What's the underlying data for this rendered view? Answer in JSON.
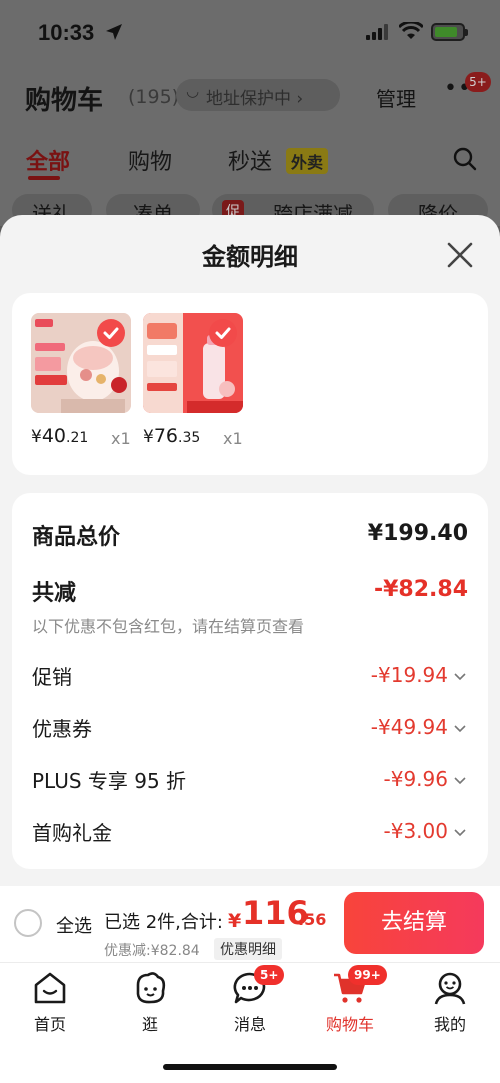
{
  "status_bar": {
    "time": "10:33"
  },
  "background_page": {
    "title": "购物车",
    "count": "(195)",
    "address": "地址保护中",
    "manage": "管理",
    "more_badge": "5+",
    "tabs": [
      "全部",
      "购物",
      "秒送"
    ],
    "waimai": "外卖",
    "filters": [
      "送礼",
      "凑单",
      "促",
      "跨店满减",
      "降价"
    ]
  },
  "sheet": {
    "title": "金额明细",
    "products": [
      {
        "price_yen": "¥",
        "price_int": "40",
        "price_dec": ".21",
        "qty": "x1"
      },
      {
        "price_yen": "¥",
        "price_int": "76",
        "price_dec": ".35",
        "qty": "x1"
      }
    ],
    "summary": {
      "total_label": "商品总价",
      "total_value": "¥199.40",
      "reduce_label": "共减",
      "reduce_value": "-¥82.84",
      "note": "以下优惠不包含红包，请在结算页查看",
      "discounts": [
        {
          "label": "促销",
          "value": "-¥19.94"
        },
        {
          "label": "优惠券",
          "value": "-¥49.94"
        },
        {
          "label": "PLUS 专享 95 折",
          "value": "-¥9.96"
        },
        {
          "label": "首购礼金",
          "value": "-¥3.00"
        }
      ]
    }
  },
  "checkout": {
    "select_all": "全选",
    "selected_text": "已选 2件,合计:",
    "total_yen": "¥",
    "total_int": "116",
    "total_dec": ".56",
    "discount_text": "优惠减:¥82.84",
    "detail_label": "优惠明细",
    "button": "去结算"
  },
  "tabbar": {
    "items": [
      {
        "label": "首页"
      },
      {
        "label": "逛"
      },
      {
        "label": "消息",
        "badge": "5+"
      },
      {
        "label": "购物车",
        "badge": "99+"
      },
      {
        "label": "我的"
      }
    ]
  },
  "colors": {
    "accent_red": "#e53128",
    "discount_red": "#e33a2f",
    "sheet_bg": "#f3f3f3"
  }
}
